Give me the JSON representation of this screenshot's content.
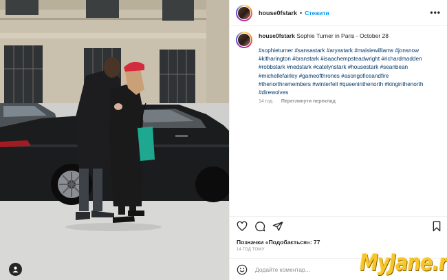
{
  "post": {
    "username": "house0fstark",
    "follow_label": "Стежити",
    "more_label": "•••",
    "caption_text": "Sophie Turner in Paris - October 28",
    "hashtags": "#sophieturner #sansastark #aryastark #maisiewilliams #jonsnow #kitharington #branstark #isaachempsteadwright #richardmadden #robbstark #nedstark #catelynstark #housestark #seanbean #michellefairley #gameofthrones #asongoficeandfire #thenorthremembers #winterfell #queeninthenorth #kinginthenorth #direwolves",
    "caption_age": "14 год.",
    "see_translation": "Переглянути переклад",
    "likes_label": "Позначки «Подобається»: 77",
    "time_ago": "14 ГОД ТОМУ",
    "comment_placeholder": "Додайте коментар..."
  },
  "icons": {
    "like": "heart-icon",
    "comment": "comment-icon",
    "share": "share-icon",
    "save": "bookmark-icon",
    "emoji": "smile-icon",
    "tag": "user-tag-icon"
  },
  "colors": {
    "link": "#0095f6",
    "hashtag": "#00376b",
    "muted": "#8e8e8e",
    "text": "#262626"
  },
  "watermark": "MyJane.ru"
}
